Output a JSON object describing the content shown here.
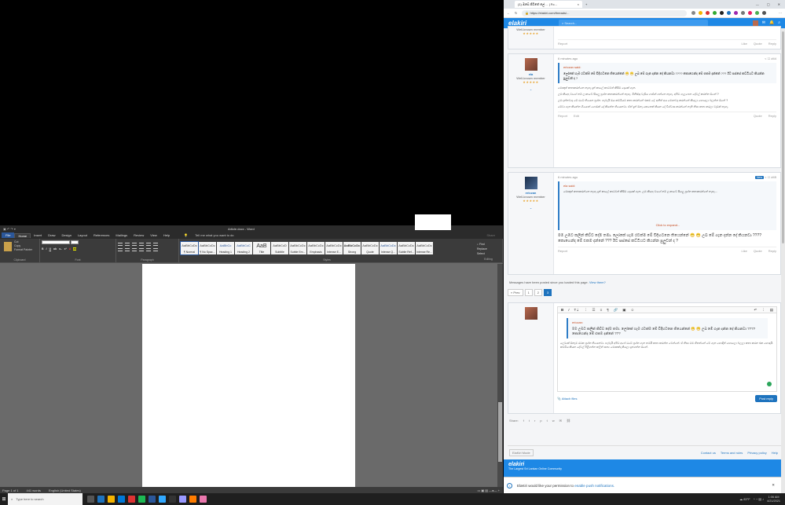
{
  "word": {
    "doc_title": "Article.docx - Word",
    "tabs": [
      "File",
      "Home",
      "Insert",
      "Draw",
      "Design",
      "Layout",
      "References",
      "Mailings",
      "Review",
      "View",
      "Help"
    ],
    "tell_me": "Tell me what you want to do",
    "share": "Share",
    "clipboard": {
      "paste": "Paste",
      "cut": "Cut",
      "copy": "Copy",
      "format_painter": "Format Painter",
      "label": "Clipboard"
    },
    "font_label": "Font",
    "paragraph_label": "Paragraph",
    "styles_label": "Styles",
    "editing_label": "Editing",
    "styles": [
      {
        "preview": "AaBbCcDc",
        "name": "¶ Normal"
      },
      {
        "preview": "AaBbCcDc",
        "name": "¶ No Spac..."
      },
      {
        "preview": "AaBbCc",
        "name": "Heading 1"
      },
      {
        "preview": "AaBbCcC",
        "name": "Heading 2"
      },
      {
        "preview": "AaB",
        "name": "Title"
      },
      {
        "preview": "AaBbCcD",
        "name": "Subtitle"
      },
      {
        "preview": "AaBbCcDc",
        "name": "Subtle Em..."
      },
      {
        "preview": "AaBbCcDc",
        "name": "Emphasis"
      },
      {
        "preview": "AaBbCcDc",
        "name": "Intense E..."
      },
      {
        "preview": "AaBbCcDc",
        "name": "Strong"
      },
      {
        "preview": "AaBbCcDc",
        "name": "Quote"
      },
      {
        "preview": "AaBbCcDc",
        "name": "Intense Q..."
      },
      {
        "preview": "AaBbCcDc",
        "name": "Subtle Ref..."
      },
      {
        "preview": "AaBbCcDc",
        "name": "Intense Re..."
      }
    ],
    "editing": {
      "find": "Find",
      "replace": "Replace",
      "select": "Select"
    },
    "status": {
      "page": "Page 1 of 1",
      "words": "441 words",
      "language": "English (United States)"
    }
  },
  "browser": {
    "tab_title": "(1) ඔබේ ජීවිතේ ලේ ... | Fo...",
    "url": "https://elakiri.com/threads/...",
    "site_logo": "elakiri",
    "search_placeholder": "Search..."
  },
  "posts": [
    {
      "partial": true,
      "title": "Well-known member",
      "actions_left": "Report",
      "actions_right": [
        "Like",
        "Quote",
        "Reply"
      ]
    },
    {
      "time": "6 minutes ago",
      "user": "ela",
      "title": "Well-known member",
      "quote_head": "ericzan said:",
      "quote": "ලෝකේ හැම රටක්ම මේ විදිහටනෙ තියෙන්නේ 😁 😁 උබ මේ ගැන දන්න දේ කියනවා ???? කොහෙන්ද මේ එකම දන්නේ ??? ඊට පස්සේ කට්ටියට කියන්න පුලුවන් ද ?",
      "paragraphs": [
        "මොකුත් කතාකරන්නෙ නැහැ දැන් කාලේ කාටවත් කිසිම දෙයක් ගැන.",
        "උඹ කියපු වාගේ නම් ලංකාවේ සියලු ප්‍රශ්න කතාකරන්නේ නැහැ. මිනිස්සු වැඩිය ගණන් ගන්නෙ නැහැ. අපිට ගැලපෙන දේවල් කරන්න ඕනේ ?",
        "උඹ දන්නවාද මේ රටේ තියෙන ප්‍රශ්න. හැබැයි ඔය කට්ටියම කතා කරන්නේ එකම දේ. අනිත් අය මොනවද කරන්නේ කියලා හොයලා බලන්න ඕනේ ?",
        "මේවා ගැන කියන්න ගියොත් ගොඩක් දේ කියන්න තියෙනවා. ඒත් දැන් ඕනෑ කෙනෙක් කියන දේ විශ්වාස කරන්නේ නැති නිසා කතා කරලා වැඩක් නැහැ."
      ],
      "actions_left": [
        "Report",
        "Edit"
      ],
      "actions_right": [
        "Quote",
        "Reply"
      ]
    },
    {
      "time": "6 minutes ago",
      "badge": "New",
      "user": "ericzan",
      "title": "Well-known member",
      "quote_head": "ela said:",
      "quote": "මොකුත් කතාකරන්නෙ නැහැ දැන් කාලේ කාටවත් කිසිම දෙයක් ගැන. උඹ කියපු වාගේ නම් ලංකාවේ සියලු ප්‍රශ්න කතාකරන්නේ නැහැ...",
      "expand": "Click to expand...",
      "body": "මම උඹට කලින් කිව්ව දේම තමා. ලෝකේ හැම රටක්ම මේ විදිහටනෙ තියෙන්නේ 😁 😁 උබ මේ ගැන දන්න දේ කියනවා ???? කොහෙන්ද මේ එකම දන්නේ ??? ඊට පස්සේ කට්ටියට කියන්න පුලුවන් ද ?",
      "actions_left": "Report",
      "actions_right": [
        "Like",
        "Quote",
        "Reply"
      ]
    }
  ],
  "notice": {
    "text": "Messages have been posted since you loaded this page.",
    "link": "View them?"
  },
  "pager": {
    "prev": "« Prev",
    "pages": [
      "1",
      "2",
      "3"
    ],
    "current": "3"
  },
  "reply": {
    "quote_head": "ericzan:",
    "quote": "මම උඹට කලින් කිව්ව දේම තමා. ලෝකේ හැම රටක්ම මේ විදිහටනෙ තියෙන්නේ 😁 😁 උබ මේ ගැන දන්න දේ කියනවා ???? කොහෙන්ද මේ එකම දන්නේ ???",
    "draft": "ලෝකේ ඕනෑම රටක ප්‍රශ්න තියෙනවා. හැබැයි අපිට අපේ රටේ ප්‍රශ්න ගැන තමයි කතා කරන්න වෙන්නේ. ඒ නිසා මම හිතන්නේ මේ ගැන හොඳින් හොයලා බලලා කතා කරන එක හොඳයි. කට්ටිය කියන දේවල් පිළිගන්න කලින් සත්‍ය මොකක්ද කියලා දැනගන්න ඕනේ.",
    "attach": "Attach files",
    "post": "Post reply"
  },
  "share_label": "Share:",
  "footer": {
    "mode": "ElaKiri Mode",
    "links": [
      "Contact us",
      "Terms and rules",
      "Privacy policy",
      "Help"
    ],
    "logo": "elakiri",
    "tagline": "The Largest Sri Lankan Online Community"
  },
  "push": {
    "text": "ElaKiri would like your permission to",
    "link": "enable push notifications."
  },
  "taskbar": {
    "search": "Type here to search",
    "weather": "83°F",
    "time": "1:06 AM",
    "date": "4/21/2021"
  }
}
